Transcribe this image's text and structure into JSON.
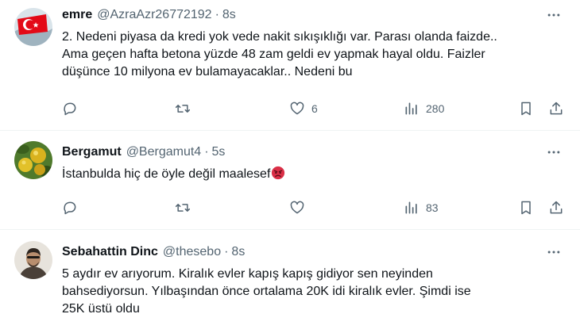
{
  "tweets": [
    {
      "name": "emre",
      "handle": "@AzraAzr26772192",
      "dot": "·",
      "time": "8s",
      "lines": [
        "2. Nedeni piyasa da kredi yok vede nakit sıkışıklığı var. Parası olanda faizde..",
        "Ama geçen hafta betona yüzde 48 zam geldi ev yapmak hayal oldu. Faizler",
        "düşünce 10 milyona ev bulamayacaklar.. Nedeni bu"
      ],
      "reply_count": "",
      "retweet_count": "",
      "like_count": "6",
      "view_count": "280"
    },
    {
      "name": "Bergamut",
      "handle": "@Bergamut4",
      "dot": "·",
      "time": "5s",
      "lines": [
        "İstanbulda hiç de öyle değil maalesef"
      ],
      "emoji": "angry-face",
      "reply_count": "",
      "retweet_count": "",
      "like_count": "",
      "view_count": "83"
    },
    {
      "name": "Sebahattin Dinc",
      "handle": "@thesebo",
      "dot": "·",
      "time": "8s",
      "lines": [
        "5 aydır ev arıyorum. Kiralık evler kapış kapış gidiyor sen neyinden",
        "bahsediyorsun. Yılbaşından önce ortalama 20K idi kiralık evler. Şimdi ise",
        "25K üstü oldu"
      ]
    }
  ],
  "colors": {
    "text": "#0f1419",
    "secondary": "#536471",
    "divider": "#eff3f4"
  },
  "icons": [
    "more-icon",
    "reply-icon",
    "retweet-icon",
    "like-icon",
    "views-icon",
    "bookmark-icon",
    "share-icon"
  ]
}
